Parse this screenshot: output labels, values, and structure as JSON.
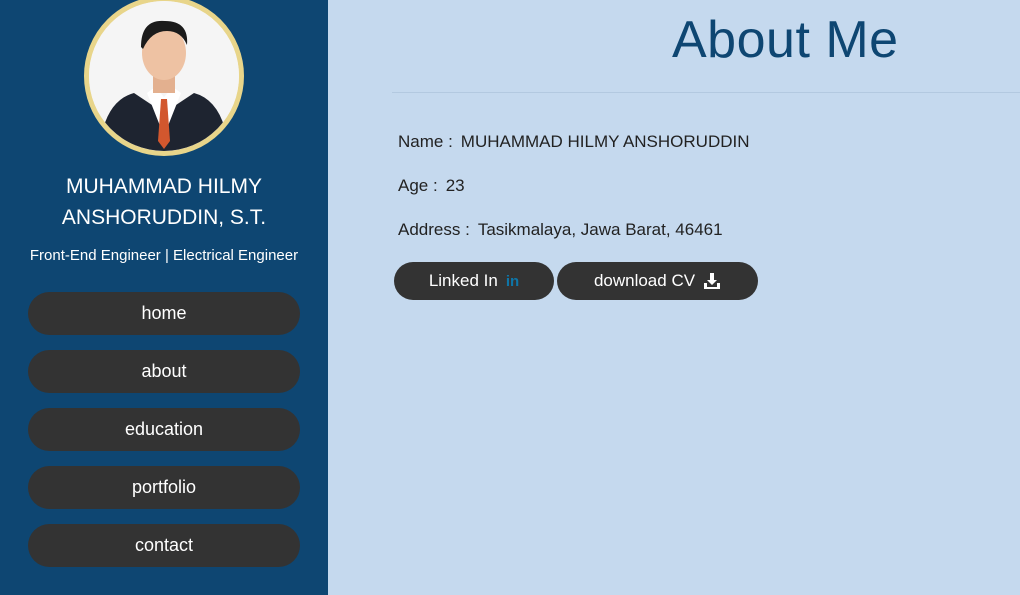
{
  "profile": {
    "name_line1": "MUHAMMAD HILMY",
    "name_line2": "ANSHORUDDIN, S.T.",
    "subtitle": "Front-End Engineer | Electrical Engineer"
  },
  "nav": {
    "items": [
      {
        "label": "home"
      },
      {
        "label": "about"
      },
      {
        "label": "education"
      },
      {
        "label": "portfolio"
      },
      {
        "label": "contact"
      }
    ]
  },
  "main": {
    "title": "About Me",
    "name_label": "Name :",
    "name_value": "MUHAMMAD HILMY ANSHORUDDIN",
    "age_label": "Age :",
    "age_value": "23",
    "address_label": "Address :",
    "address_value": "Tasikmalaya, Jawa Barat, 46461"
  },
  "actions": {
    "linkedin_label": "Linked In",
    "linkedin_icon": "in",
    "download_label": "download CV"
  },
  "colors": {
    "sidebar": "#0e4672",
    "background": "#c5d9ee",
    "button": "#333333",
    "title": "#0e4672",
    "avatar_border": "#e8d58a",
    "linkedin": "#0e76a8"
  }
}
